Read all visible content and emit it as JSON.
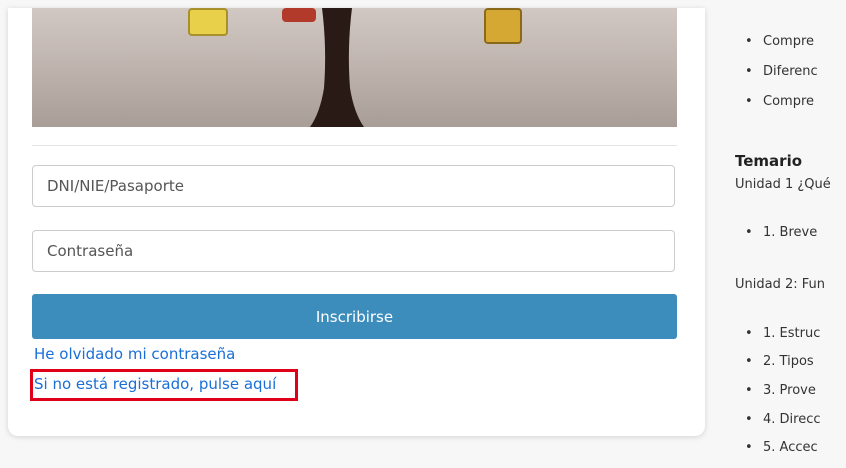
{
  "login": {
    "id_placeholder": "DNI/NIE/Pasaporte",
    "password_placeholder": "Contraseña",
    "submit_label": "Inscribirse",
    "forgot_password_link": "He olvidado mi contraseña",
    "register_link": "Si no está registrado, pulse aquí"
  },
  "course": {
    "bullets_top": [
      "Compre",
      "Diferenc",
      "Compre"
    ],
    "temario_heading": "Temario",
    "unit1_title": "Unidad 1 ¿Qué",
    "unit1_items": [
      "1. Breve"
    ],
    "unit2_title": "Unidad 2: Fun",
    "unit2_items": [
      "1. Estruc",
      "2. Tipos",
      "3. Prove",
      "4. Direcc",
      "5. Accec"
    ]
  },
  "colors": {
    "primary_button": "#3c8dbc",
    "link": "#1a6fd6",
    "highlight_border": "#e0001a"
  }
}
